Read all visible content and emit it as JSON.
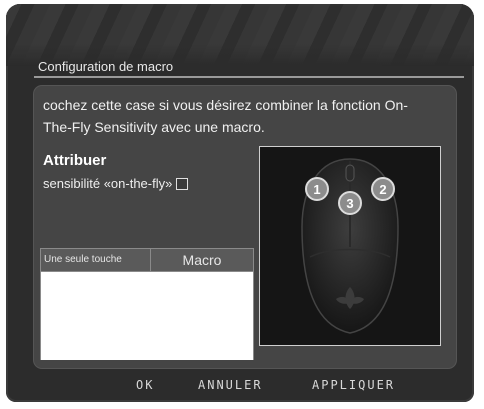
{
  "dialog": {
    "title": "Configuration de macro",
    "description": "cochez cette case si vous désirez combiner la fonction On-The-Fly Sensitivity avec une macro.",
    "assign": {
      "heading": "Attribuer",
      "label": "sensibilité «on-the-fly»",
      "checked": false
    },
    "table": {
      "col1": "Une seule touche",
      "col2": "Macro"
    },
    "mouse": {
      "buttons": [
        "1",
        "3",
        "2"
      ]
    }
  },
  "footer": {
    "ok": "OK",
    "cancel": "ANNULER",
    "apply": "APPLIQUER"
  }
}
